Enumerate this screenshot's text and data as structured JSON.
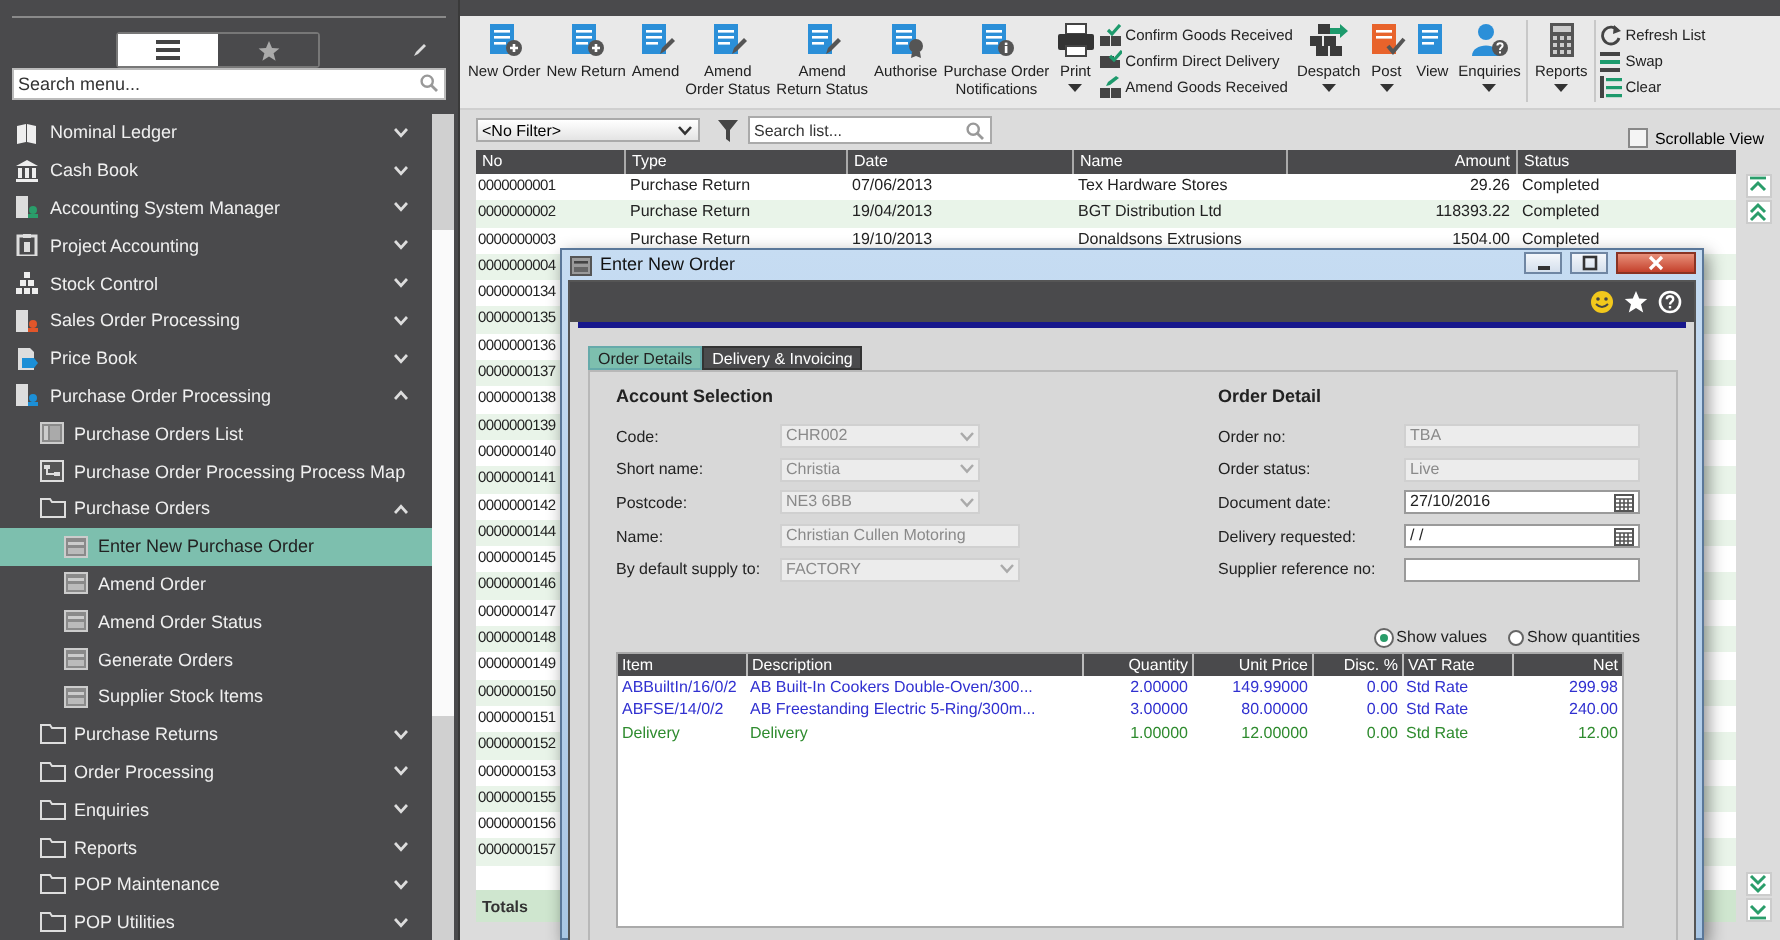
{
  "sidebar": {
    "view_toggle": [
      {
        "kind": "list",
        "selected": true
      },
      {
        "kind": "favourites",
        "selected": false
      }
    ],
    "search": {
      "placeholder": "Search menu..."
    },
    "items": [
      {
        "label": "Nominal Ledger",
        "kind": "module",
        "expanded": false,
        "selected": false
      },
      {
        "label": "Cash Book",
        "kind": "module",
        "expanded": false,
        "selected": false
      },
      {
        "label": "Accounting System Manager",
        "kind": "module",
        "expanded": false,
        "selected": false
      },
      {
        "label": "Project Accounting",
        "kind": "module",
        "expanded": false,
        "selected": false
      },
      {
        "label": "Stock Control",
        "kind": "module",
        "expanded": false,
        "selected": false
      },
      {
        "label": "Sales Order Processing",
        "kind": "module",
        "expanded": false,
        "selected": false
      },
      {
        "label": "Price Book",
        "kind": "module",
        "expanded": false,
        "selected": false
      },
      {
        "label": "Purchase Order Processing",
        "kind": "module",
        "expanded": true,
        "selected": false,
        "children": [
          {
            "label": "Purchase Orders List",
            "kind": "list",
            "selected": false
          },
          {
            "label": "Purchase Order Processing Process Map",
            "kind": "map",
            "selected": false
          },
          {
            "label": "Purchase Orders",
            "kind": "folder",
            "expanded": true,
            "selected": false,
            "children": [
              {
                "label": "Enter New Purchase Order",
                "kind": "form",
                "selected": true
              },
              {
                "label": "Amend Order",
                "kind": "form",
                "selected": false
              },
              {
                "label": "Amend Order Status",
                "kind": "form",
                "selected": false
              },
              {
                "label": "Generate Orders",
                "kind": "form",
                "selected": false
              },
              {
                "label": "Supplier Stock Items",
                "kind": "form",
                "selected": false
              }
            ]
          },
          {
            "label": "Purchase Returns",
            "kind": "folder",
            "expanded": false,
            "selected": false
          },
          {
            "label": "Order Processing",
            "kind": "folder",
            "expanded": false,
            "selected": false
          },
          {
            "label": "Enquiries",
            "kind": "folder",
            "expanded": false,
            "selected": false
          },
          {
            "label": "Reports",
            "kind": "folder",
            "expanded": false,
            "selected": false
          },
          {
            "label": "POP Maintenance",
            "kind": "folder",
            "expanded": false,
            "selected": false
          },
          {
            "label": "POP Utilities",
            "kind": "folder",
            "expanded": false,
            "selected": false
          }
        ]
      }
    ]
  },
  "toolbar": [
    {
      "kind": "button",
      "label": "New Order",
      "dropdown": false
    },
    {
      "kind": "button",
      "label": "New Return",
      "dropdown": false
    },
    {
      "kind": "button",
      "label": "Amend",
      "dropdown": false
    },
    {
      "kind": "button",
      "label": "Amend\nOrder Status",
      "dropdown": false
    },
    {
      "kind": "button",
      "label": "Amend\nReturn Status",
      "dropdown": false
    },
    {
      "kind": "button",
      "label": "Authorise",
      "dropdown": false
    },
    {
      "kind": "button",
      "label": "Purchase Order\nNotifications",
      "dropdown": false
    },
    {
      "kind": "button",
      "label": "Print",
      "dropdown": true
    },
    {
      "kind": "stack",
      "items": [
        {
          "label": "Confirm Goods Received"
        },
        {
          "label": "Confirm Direct Delivery"
        },
        {
          "label": "Amend Goods Received"
        }
      ]
    },
    {
      "kind": "button",
      "label": "Despatch",
      "dropdown": true
    },
    {
      "kind": "button",
      "label": "Post",
      "dropdown": true
    },
    {
      "kind": "button",
      "label": "View",
      "dropdown": false
    },
    {
      "kind": "button",
      "label": "Enquiries",
      "dropdown": true
    },
    {
      "kind": "separator"
    },
    {
      "kind": "button",
      "label": "Reports",
      "dropdown": true
    },
    {
      "kind": "separator"
    },
    {
      "kind": "stack",
      "items": [
        {
          "label": "Refresh List"
        },
        {
          "label": "Swap"
        },
        {
          "label": "Clear"
        }
      ]
    }
  ],
  "list_filter": {
    "value": "<No Filter>"
  },
  "list_search": {
    "placeholder": "Search list..."
  },
  "scrollable_view": {
    "label": "Scrollable View",
    "checked": false
  },
  "table": {
    "columns": [
      "No",
      "Type",
      "Date",
      "Name",
      "Amount",
      "Status"
    ],
    "rows": [
      {
        "no": "0000000001",
        "type": "Purchase Return",
        "date": "07/06/2013",
        "name": "Tex Hardware Stores",
        "amount": "29.26",
        "status": "Completed"
      },
      {
        "no": "0000000002",
        "type": "Purchase Return",
        "date": "19/04/2013",
        "name": "BGT Distribution Ltd",
        "amount": "118393.22",
        "status": "Completed"
      },
      {
        "no": "0000000003",
        "type": "Purchase Return",
        "date": "19/10/2013",
        "name": "Donaldsons Extrusions",
        "amount": "1504.00",
        "status": "Completed"
      },
      {
        "no": "0000000004"
      },
      {
        "no": "0000000134"
      },
      {
        "no": "0000000135"
      },
      {
        "no": "0000000136"
      },
      {
        "no": "0000000137"
      },
      {
        "no": "0000000138"
      },
      {
        "no": "0000000139"
      },
      {
        "no": "0000000140"
      },
      {
        "no": "0000000141"
      },
      {
        "no": "0000000142"
      },
      {
        "no": "0000000144"
      },
      {
        "no": "0000000145"
      },
      {
        "no": "0000000146"
      },
      {
        "no": "0000000147"
      },
      {
        "no": "0000000148"
      },
      {
        "no": "0000000149"
      },
      {
        "no": "0000000150"
      },
      {
        "no": "0000000151"
      },
      {
        "no": "0000000152"
      },
      {
        "no": "0000000153"
      },
      {
        "no": "0000000155"
      },
      {
        "no": "0000000156"
      },
      {
        "no": "0000000157"
      }
    ],
    "totals_label": "Totals"
  },
  "dialog": {
    "title": "Enter New Order",
    "tabs": [
      {
        "label": "Order Details",
        "selected": true
      },
      {
        "label": "Delivery & Invoicing",
        "selected": false
      }
    ],
    "sections": [
      {
        "title": "Account Selection",
        "fields": [
          {
            "label": "Code:",
            "value": "CHR002",
            "kind": "combo",
            "disabled": true
          },
          {
            "label": "Short name:",
            "value": "Christia",
            "kind": "combo",
            "disabled": true
          },
          {
            "label": "Postcode:",
            "value": "NE3 6BB",
            "kind": "combo",
            "disabled": true
          },
          {
            "label": "Name:",
            "value": "Christian Cullen Motoring",
            "kind": "text",
            "disabled": true
          },
          {
            "label": "By default supply to:",
            "value": "FACTORY",
            "kind": "combo",
            "disabled": true
          }
        ]
      },
      {
        "title": "Order Detail",
        "fields": [
          {
            "label": "Order no:",
            "value": "TBA",
            "kind": "text",
            "disabled": true
          },
          {
            "label": "Order status:",
            "value": "Live",
            "kind": "text",
            "disabled": true
          },
          {
            "label": "Document date:",
            "value": "27/10/2016",
            "kind": "date",
            "disabled": false
          },
          {
            "label": "Delivery requested:",
            "value": "/ /",
            "kind": "date",
            "disabled": false
          },
          {
            "label": "Supplier reference no:",
            "kind": "text",
            "disabled": false
          }
        ]
      }
    ],
    "display_mode": [
      {
        "label": "Show values",
        "selected": true
      },
      {
        "label": "Show quantities",
        "selected": false
      }
    ],
    "lines": {
      "columns": [
        "Item",
        "Description",
        "Quantity",
        "Unit Price",
        "Disc. %",
        "VAT Rate",
        "Net"
      ],
      "rows": [
        {
          "item": "ABBuiltIn/16/0/2",
          "description": "AB Built-In Cookers Double-Oven/300...",
          "quantity": "2.00000",
          "unit_price": "149.99000",
          "discount": "0.00",
          "vat_rate": "Std Rate",
          "net": "299.98",
          "color": "#3030d0"
        },
        {
          "item": "ABFSE/14/0/2",
          "description": "AB Freestanding Electric 5-Ring/300m...",
          "quantity": "3.00000",
          "unit_price": "80.00000",
          "discount": "0.00",
          "vat_rate": "Std Rate",
          "net": "240.00",
          "color": "#3030d0"
        },
        {
          "item": "Delivery",
          "description": "Delivery",
          "quantity": "1.00000",
          "unit_price": "12.00000",
          "discount": "0.00",
          "vat_rate": "Std Rate",
          "net": "12.00",
          "color": "#2e8b2e"
        }
      ]
    }
  }
}
